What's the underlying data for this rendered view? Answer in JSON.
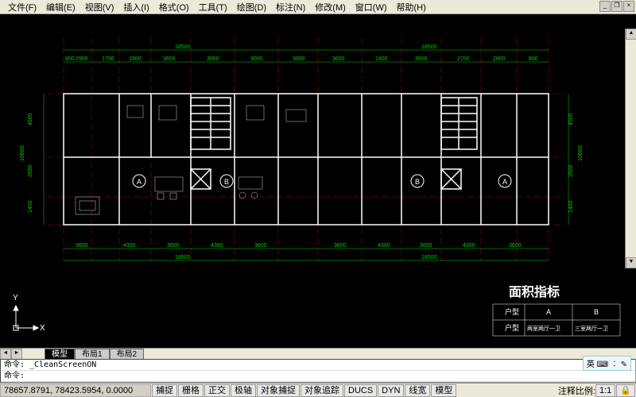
{
  "menu": {
    "items": [
      "文件(F)",
      "编辑(E)",
      "视图(V)",
      "插入(I)",
      "格式(O)",
      "工具(T)",
      "绘图(D)",
      "标注(N)",
      "修改(M)",
      "窗口(W)",
      "帮助(H)"
    ]
  },
  "win_controls": {
    "min": "_",
    "restore": "❐",
    "close": "×"
  },
  "tabs": {
    "active": "模型",
    "layout1": "布局1",
    "layout2": "布局2"
  },
  "command": {
    "line1": "命令: _CleanScreenON",
    "prompt": "命令:"
  },
  "status": {
    "coords": "78657.8791, 78423.5954, 0.0000",
    "buttons": [
      "捕捉",
      "栅格",
      "正交",
      "极轴",
      "对象捕捉",
      "对象追踪",
      "DUCS",
      "DYN",
      "线宽",
      "模型"
    ],
    "scale_label": "注释比例:",
    "scale_value": "1:1"
  },
  "ime": {
    "text": "英 ⌨ ︰ ✎"
  },
  "plan": {
    "title": "面积指标",
    "units": [
      "A",
      "B",
      "B",
      "A"
    ],
    "dims_top_total": [
      "18500",
      "18500"
    ],
    "dims_top": [
      "800",
      "2900",
      "1700",
      "1800",
      "3600",
      "3000",
      "3000",
      "3000",
      "3600",
      "1800",
      "3600",
      "2700",
      "2800",
      "800"
    ],
    "dims_bottom": [
      "3600",
      "4300",
      "3600",
      "4300",
      "3600",
      "3600",
      "4300",
      "3600",
      "4300",
      "3600"
    ],
    "dims_bottom_total": [
      "18500",
      "18500"
    ],
    "dims_left": [
      "1400",
      "2600",
      "4500"
    ],
    "dims_left_total": "10600",
    "dims_right": [
      "4500",
      "2600",
      "1400"
    ],
    "dims_right_total": "10600",
    "table": {
      "col_a": "A",
      "col_b": "B",
      "row1_label": "户型",
      "row2_a": "两室两厅一卫",
      "row2_b": "三室两厅一卫",
      "row2_label": "户型"
    }
  },
  "ucs": {
    "x": "X",
    "y": "Y"
  },
  "scroll": {
    "left": "◄",
    "right": "►",
    "up": "▲",
    "down": "▼"
  }
}
